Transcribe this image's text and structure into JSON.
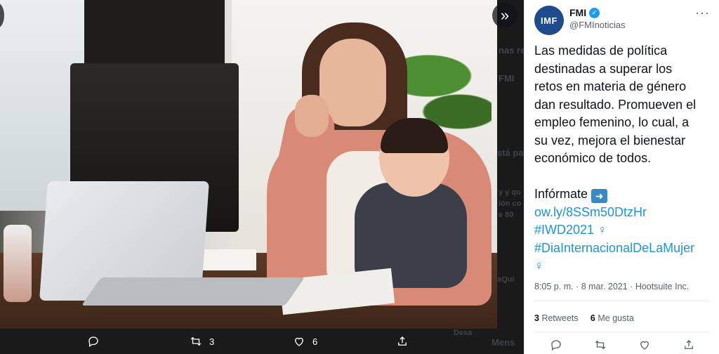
{
  "viewer": {
    "actions": {
      "reply_count": "",
      "retweet_count": "3",
      "like_count": "6"
    },
    "background_fragments": [
      "nas re",
      "FMI",
      "stá pa",
      "y y qu",
      "ión co",
      "e 80",
      "aQui",
      "Desa",
      "Mens"
    ]
  },
  "tweet": {
    "author_name": "FMI",
    "author_handle": "@FMInoticias",
    "avatar_text": "IMF",
    "text_lines": [
      "Las medidas de política",
      "destinadas a superar los",
      "retos en materia de género",
      "dan resultado. Promueven el",
      "empleo femenino, lo cual, a",
      "su vez, mejora el bienestar",
      "económico de todos."
    ],
    "cta": "Infórmate",
    "link": "ow.ly/8SSm50DtzHr",
    "hashtag1": "#IWD2021",
    "hashtag2": "#DiaInternacionalDeLaMujer",
    "timestamp": "8:05 p. m. · 8 mar. 2021 · Hootsuite Inc.",
    "retweets_count": "3",
    "retweets_label": "Retweets",
    "likes_count": "6",
    "likes_label": "Me gusta"
  },
  "colors": {
    "accent": "#1b95e0",
    "avatar_bg": "#1e4a8e",
    "verified": "#1d9bf0"
  }
}
